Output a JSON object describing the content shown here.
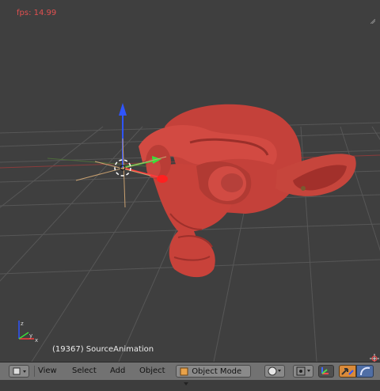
{
  "viewport": {
    "fps_text": "fps: 14.99",
    "object_info": "(19367) SourceAnimation"
  },
  "header": {
    "editor_type_icon": "3d-viewport-icon",
    "menu": {
      "view": "View",
      "select": "Select",
      "add": "Add",
      "object": "Object"
    },
    "mode": {
      "icon": "object-mode-cube-icon",
      "label": "Object Mode"
    },
    "shading_icon": "solid-sphere-icon",
    "pivot_icon": "pivot-point-icon",
    "manipulator_icon": "manipulator-toggle-icon",
    "transform_icons": [
      "translate-icon",
      "rotate-icon"
    ]
  },
  "colors": {
    "viewport_bg": "#3f3f3f",
    "header_bg": "#727272",
    "fps_text": "#e25050",
    "monkey": "#c8423a",
    "axis_x": "#ff3a3a",
    "axis_y": "#3adf3a",
    "axis_z": "#2f55ff"
  }
}
